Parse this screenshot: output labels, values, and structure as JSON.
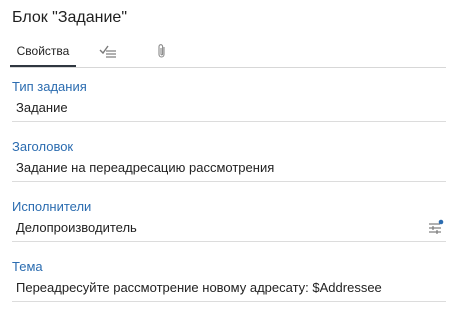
{
  "panel": {
    "title": "Блок \"Задание\""
  },
  "tabs": [
    {
      "label": "Свойства",
      "active": true
    },
    {
      "icon": "check-list-icon"
    },
    {
      "icon": "paperclip-icon"
    }
  ],
  "fields": {
    "task_type": {
      "label": "Тип задания",
      "value": "Задание"
    },
    "heading": {
      "label": "Заголовок",
      "value": "Задание на переадресацию рассмотрения"
    },
    "performers": {
      "label": "Исполнители",
      "value": "Делопроизводитель",
      "icon": "settings-sliders-icon"
    },
    "subject": {
      "label": "Тема",
      "value": "Переадресуйте рассмотрение новому адресату: $Addressee"
    }
  },
  "colors": {
    "label": "#2b6cb0",
    "accent": "#2f3640",
    "icon_dot": "#2b6cb0"
  }
}
